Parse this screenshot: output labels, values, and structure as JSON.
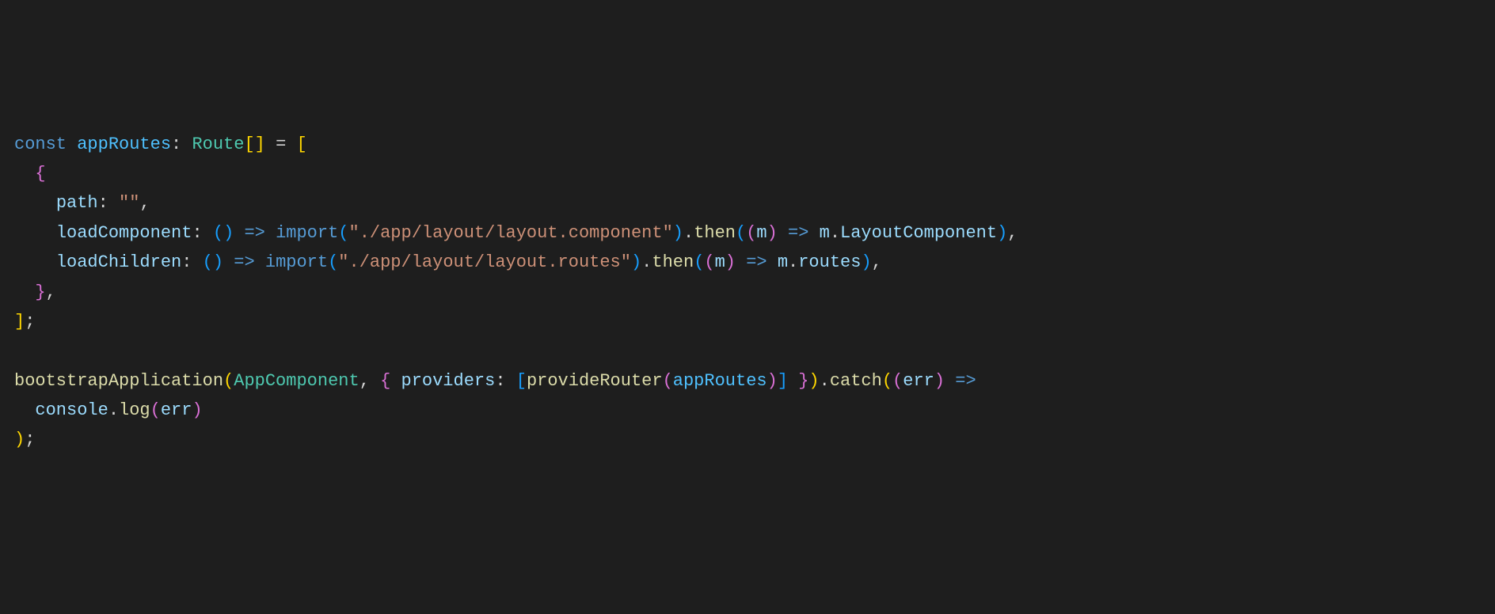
{
  "code": {
    "line1": {
      "const": "const",
      "varName": "appRoutes",
      "colon": ":",
      "type": "Route",
      "brackets": "[]",
      "equals": "=",
      "openBracket": "["
    },
    "line2": {
      "openBrace": "{"
    },
    "line3": {
      "prop": "path",
      "colon": ":",
      "value": "\"\"",
      "comma": ","
    },
    "line4": {
      "prop": "loadComponent",
      "colon": ":",
      "openParen1": "(",
      "closeParen1": ")",
      "arrow": "=>",
      "importKw": "import",
      "openParen2": "(",
      "importPath": "\"./app/layout/layout.component\"",
      "closeParen2": ")",
      "dot1": ".",
      "then": "then",
      "openParen3": "(",
      "openParen4": "(",
      "param": "m",
      "closeParen4": ")",
      "arrow2": "=>",
      "obj": "m",
      "dot2": ".",
      "component": "LayoutComponent",
      "closeParen3": ")",
      "comma": ","
    },
    "line5": {
      "prop": "loadChildren",
      "colon": ":",
      "openParen1": "(",
      "closeParen1": ")",
      "arrow": "=>",
      "importKw": "import",
      "openParen2": "(",
      "importPath": "\"./app/layout/layout.routes\"",
      "closeParen2": ")",
      "dot1": ".",
      "then": "then",
      "openParen3": "(",
      "openParen4": "(",
      "param": "m",
      "closeParen4": ")",
      "arrow2": "=>",
      "obj": "m",
      "dot2": ".",
      "routes": "routes",
      "closeParen3": ")",
      "comma": ","
    },
    "line6": {
      "closeBrace": "}",
      "comma": ","
    },
    "line7": {
      "closeBracket": "]",
      "semi": ";"
    },
    "line9": {
      "func": "bootstrapApplication",
      "openParen1": "(",
      "component": "AppComponent",
      "comma1": ",",
      "openBrace": "{",
      "prop": "providers",
      "colon": ":",
      "openBracket": "[",
      "providerFunc": "provideRouter",
      "openParen2": "(",
      "arg": "appRoutes",
      "closeParen2": ")",
      "closeBracket": "]",
      "closeBrace": "}",
      "closeParen1": ")",
      "dot": ".",
      "catch": "catch",
      "openParen3": "(",
      "openParen4": "(",
      "param": "err",
      "closeParen4": ")",
      "arrow": "=>"
    },
    "line10": {
      "console": "console",
      "dot": ".",
      "log": "log",
      "openParen": "(",
      "arg": "err",
      "closeParen": ")"
    },
    "line11": {
      "closeParen": ")",
      "semi": ";"
    }
  }
}
